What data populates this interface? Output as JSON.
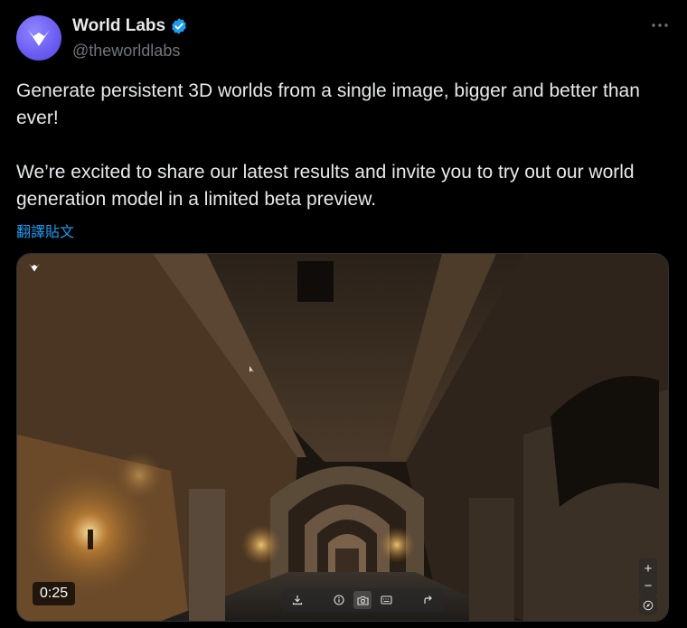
{
  "author": {
    "display_name": "World Labs",
    "handle": "@theworldlabs",
    "verified": true,
    "avatar_icon": "world-labs-logo-icon",
    "avatar_color": "#6a5cf0",
    "verified_color": "#1d9bf0"
  },
  "tweet": {
    "paragraphs": [
      "Generate persistent 3D worlds from a single image, bigger and better than ever!",
      "We’re excited to share our latest results and invite you to try out our world generation model in a limited beta preview."
    ],
    "translate_label": "翻譯貼文",
    "more_icon": "more-horizontal-icon"
  },
  "media": {
    "duration": "0:25",
    "toolbar_icons": [
      "download-icon",
      "info-icon",
      "camera-icon",
      "keyboard-icon",
      "share-arrow-icon"
    ],
    "zoom_in_label": "+",
    "zoom_out_label": "−",
    "compass_icon": "compass-icon",
    "corner_logo_icon": "world-labs-logo-icon"
  }
}
